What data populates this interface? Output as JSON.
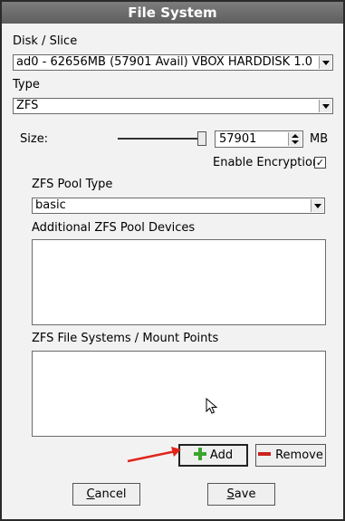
{
  "window": {
    "title": "File System"
  },
  "disk": {
    "label": "Disk / Slice",
    "selected": "ad0 - 62656MB (57901 Avail) VBOX HARDDISK 1.0"
  },
  "type": {
    "label": "Type",
    "selected": "ZFS"
  },
  "size": {
    "label": "Size:",
    "value": "57901",
    "unit": "MB",
    "slider_fraction": 1.0
  },
  "encryption": {
    "label": "Enable Encryption",
    "checked": true,
    "mark": "✓"
  },
  "zfs_pool": {
    "label": "ZFS Pool Type",
    "selected": "basic"
  },
  "pool_devices": {
    "label": "Additional ZFS Pool Devices"
  },
  "mount_points": {
    "label": "ZFS File Systems / Mount Points"
  },
  "buttons": {
    "add": "Add",
    "remove": "Remove",
    "cancel_first": "C",
    "cancel_rest": "ancel",
    "save_first": "S",
    "save_rest": "ave"
  },
  "colors": {
    "add_icon": "#3aa62e",
    "remove_icon": "#c8231e",
    "annotation_arrow": "#e0261b"
  }
}
